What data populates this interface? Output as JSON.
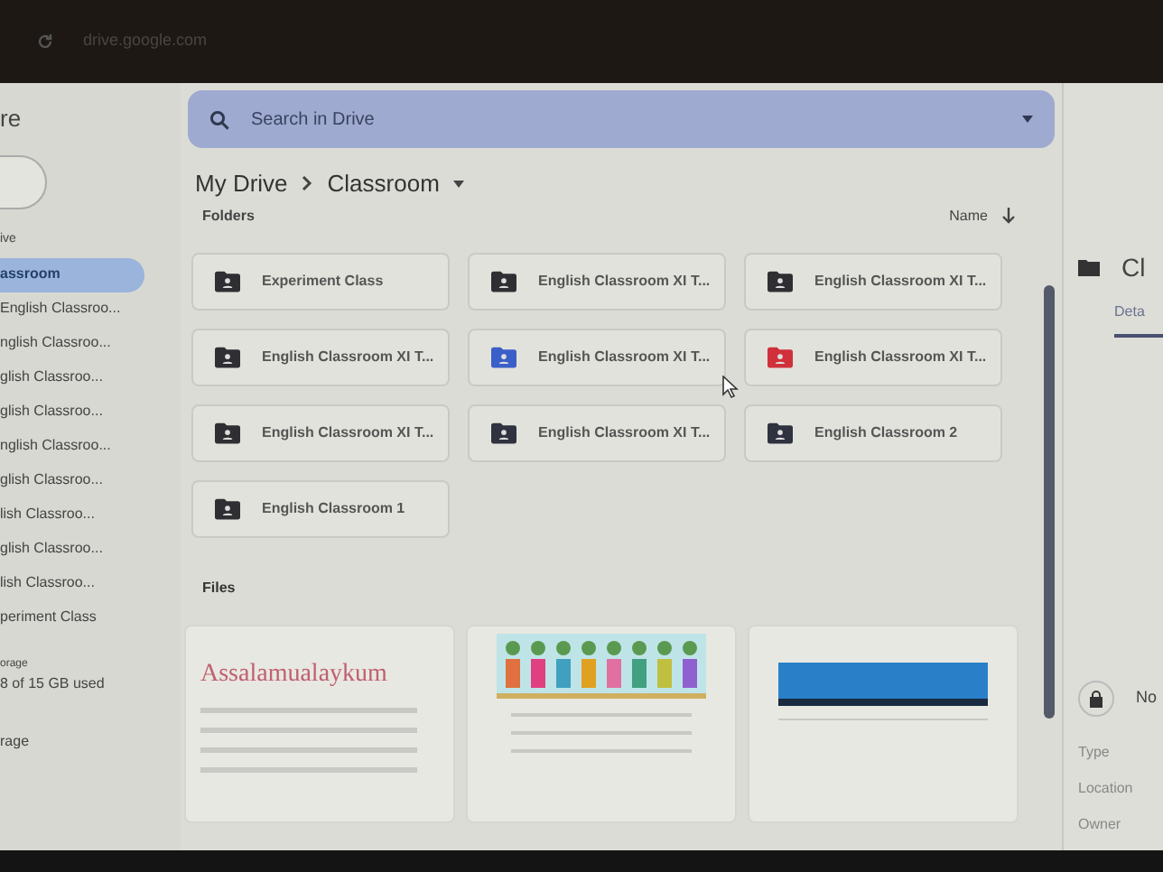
{
  "browser": {
    "url": "drive.google.com"
  },
  "sidebar": {
    "title": "re",
    "section": "ive",
    "items": [
      {
        "label": "assroom",
        "selected": true
      },
      {
        "label": "English Classroo...",
        "selected": false
      },
      {
        "label": "nglish Classroo...",
        "selected": false
      },
      {
        "label": "glish Classroo...",
        "selected": false
      },
      {
        "label": "glish Classroo...",
        "selected": false
      },
      {
        "label": "nglish Classroo...",
        "selected": false
      },
      {
        "label": "glish Classroo...",
        "selected": false
      },
      {
        "label": "lish Classroo...",
        "selected": false
      },
      {
        "label": "glish Classroo...",
        "selected": false
      },
      {
        "label": "lish Classroo...",
        "selected": false
      },
      {
        "label": "periment Class",
        "selected": false
      }
    ],
    "storage_label": "orage",
    "storage_used": "8 of 15 GB used",
    "storage_link": "rage"
  },
  "search": {
    "placeholder": "Search in Drive"
  },
  "breadcrumb": [
    "My Drive",
    "Classroom"
  ],
  "folders_heading": "Folders",
  "sort": "Name",
  "folders": [
    {
      "name": "Experiment Class",
      "color": "#2f2f33"
    },
    {
      "name": "English Classroom XI T...",
      "color": "#2f2f33"
    },
    {
      "name": "English Classroom XI T...",
      "color": "#2f2f33"
    },
    {
      "name": "English Classroom XI T...",
      "color": "#2f2f33"
    },
    {
      "name": "English Classroom XI T...",
      "color": "#3b5fc9"
    },
    {
      "name": "English Classroom XI T...",
      "color": "#d0303a"
    },
    {
      "name": "English Classroom XI T...",
      "color": "#2f2f33"
    },
    {
      "name": "English Classroom XI T...",
      "color": "#2f3340"
    },
    {
      "name": "English Classroom 2",
      "color": "#2f3340"
    },
    {
      "name": "English Classroom 1",
      "color": "#2f2f33"
    }
  ],
  "files_heading": "Files",
  "files": [
    {
      "kind": "doc",
      "heading": "Assalamualaykum"
    },
    {
      "kind": "form"
    },
    {
      "kind": "sheet"
    }
  ],
  "details": {
    "title": "Cl",
    "tab": "Deta",
    "access": "No",
    "fields": [
      "Type",
      "Location",
      "Owner"
    ]
  }
}
